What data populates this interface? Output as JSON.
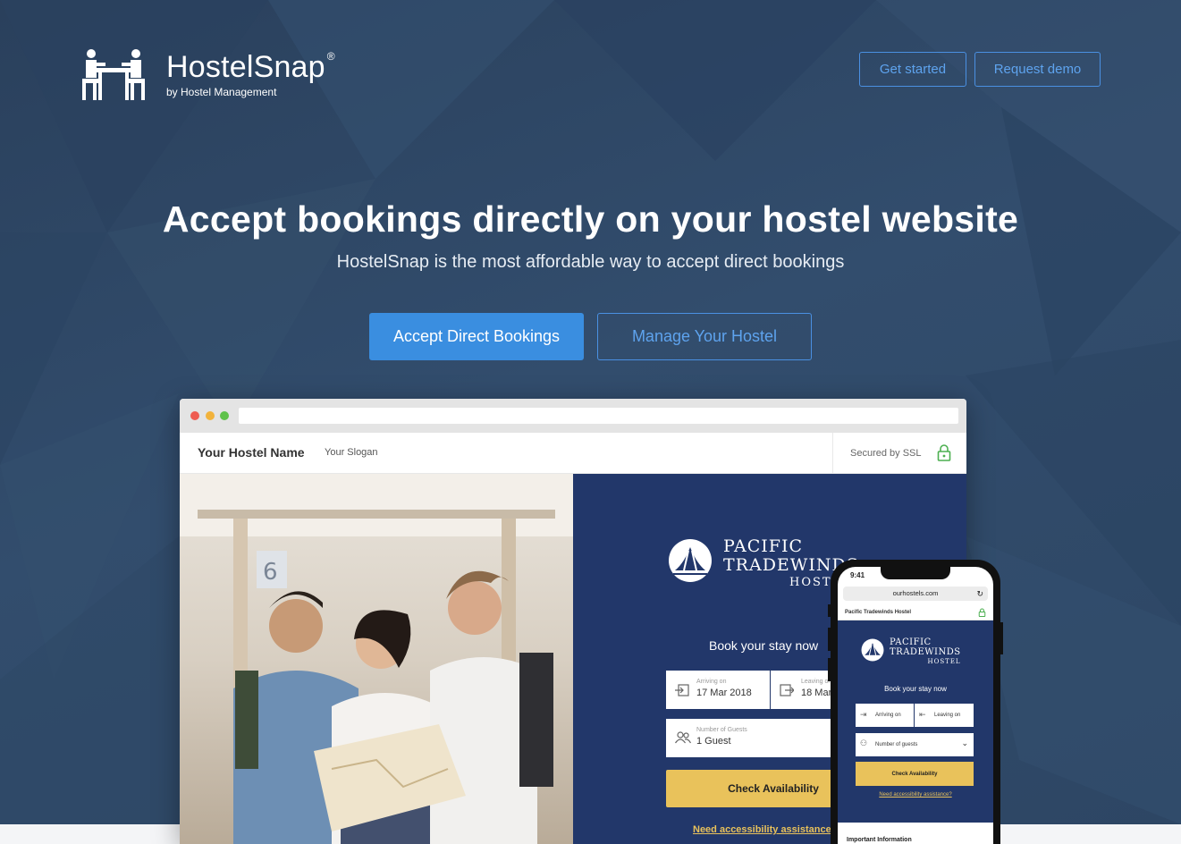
{
  "header": {
    "brand_name": "HostelSnap",
    "brand_reg": "®",
    "brand_sub": "by Hostel Management",
    "get_started_label": "Get started",
    "request_demo_label": "Request demo"
  },
  "hero": {
    "title": "Accept bookings directly on your hostel website",
    "subtitle": "HostelSnap is the most affordable way to accept direct bookings",
    "primary_cta": "Accept Direct Bookings",
    "secondary_cta": "Manage Your Hostel"
  },
  "browser_mockup": {
    "site_name": "Your Hostel Name",
    "site_slogan": "Your Slogan",
    "ssl_text": "Secured by SSL",
    "hotel_brand": {
      "line1": "PACIFIC",
      "line2": "TRADEWINDS",
      "line3": "HOSTEL"
    },
    "book_title": "Book your stay now",
    "arriving_label": "Arriving on",
    "arriving_value": "17 Mar 2018",
    "leaving_label": "Leaving on",
    "leaving_value": "18 Mar 2018",
    "guests_label": "Number of Guests",
    "guests_value": "1 Guest",
    "check_button": "Check Availability",
    "access_link": "Need accessibility assistance?"
  },
  "phone_mockup": {
    "time": "9:41",
    "url": "ourhostels.com",
    "site_name": "Pacific Tradewinds Hostel",
    "hotel_brand": {
      "line1": "PACIFIC",
      "line2": "TRADEWINDS",
      "line3": "HOSTEL"
    },
    "book_title": "Book your stay now",
    "arriving_label": "Arriving on",
    "leaving_label": "Leaving on",
    "guests_label": "Number of guests",
    "check_button": "Check Availability",
    "access_link": "Need accessibility assistance?",
    "info_label": "Important Information"
  },
  "colors": {
    "background": "#2f4866",
    "accent": "#3a8ee0",
    "booking_panel": "#22376a",
    "gold": "#e9c25b"
  }
}
